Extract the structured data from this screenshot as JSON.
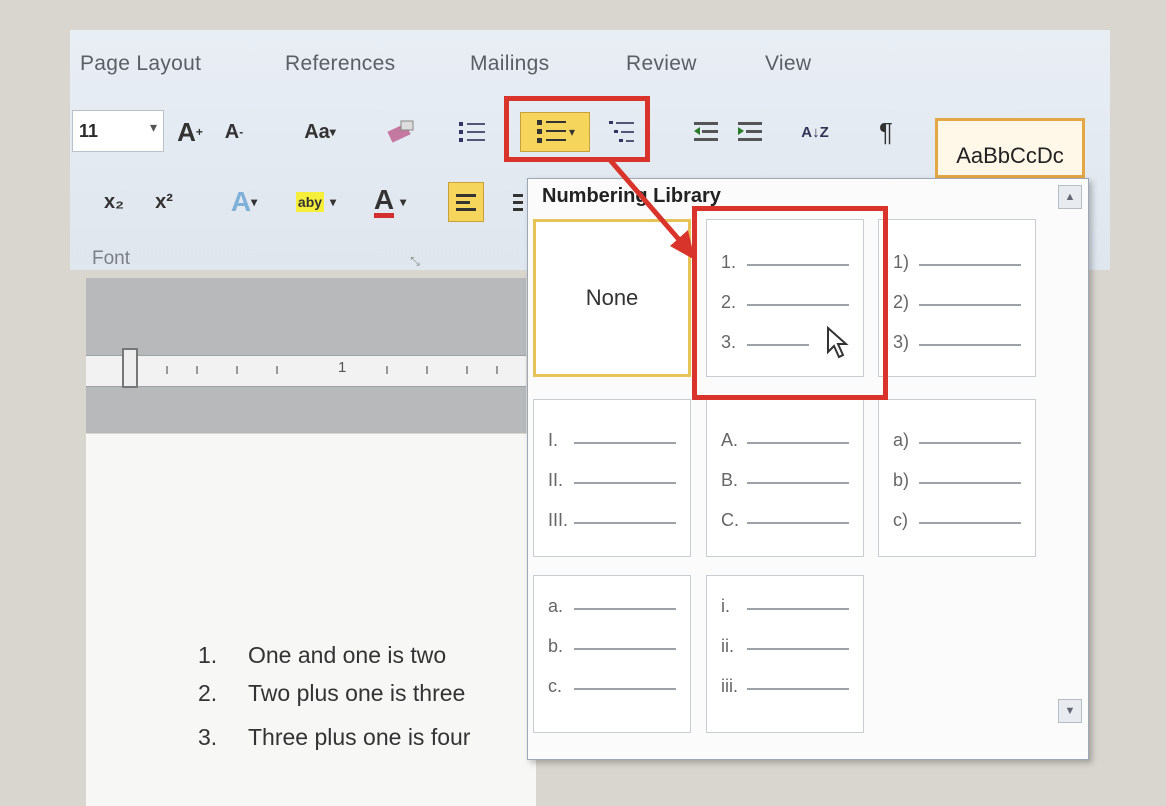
{
  "tabs": [
    "Page Layout",
    "References",
    "Mailings",
    "Review",
    "View"
  ],
  "font": {
    "size": "11",
    "group_label": "Font",
    "grow_label": "A",
    "shrink_label": "A",
    "change_case_label": "Aa",
    "subscript_label": "x₂",
    "superscript_label": "x²",
    "highlight_label": "aby",
    "font_color_label": "A"
  },
  "styles": {
    "preview": "AaBbCcDc"
  },
  "sort_label": "A↓Z",
  "pilcrow_label": "¶",
  "numbering_library": {
    "title": "Numbering Library",
    "none_label": "None",
    "formats": [
      [
        "1.",
        "2.",
        "3."
      ],
      [
        "1)",
        "2)",
        "3)"
      ],
      [
        "I.",
        "II.",
        "III."
      ],
      [
        "A.",
        "B.",
        "C."
      ],
      [
        "a)",
        "b)",
        "c)"
      ],
      [
        "a.",
        "b.",
        "c."
      ],
      [
        "i.",
        "ii.",
        "iii."
      ]
    ]
  },
  "ruler": {
    "mark": "1"
  },
  "document": {
    "lines": [
      {
        "num": "1.",
        "text": "One and one is two"
      },
      {
        "num": "2.",
        "text": "Two plus one is three"
      },
      {
        "num": "3.",
        "text": "Three plus one is four"
      }
    ]
  },
  "colors": {
    "highlight_red": "#d9342b",
    "selected_gold": "#e6c356"
  }
}
